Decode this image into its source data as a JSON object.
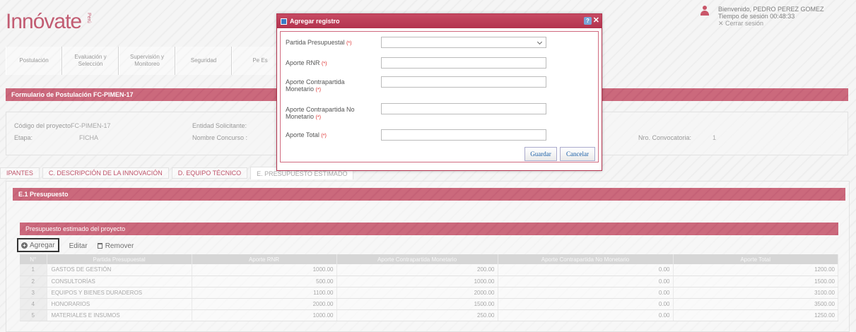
{
  "header": {
    "logo_text": "Innóvate",
    "logo_suffix": "Perú",
    "welcome": "Bienvenido, PEDRO PEREZ GOMEZ",
    "session_time": "Tiempo de sesión 00:48:33",
    "logout": "✕ Cerrar sesión"
  },
  "menu": [
    "Postulación",
    "Evaluación y Selección",
    "Supervisión y Monitoreo",
    "Seguridad",
    "Pe Es"
  ],
  "form_title": "Formulario de Postulación FC-PIMEN-17",
  "info": {
    "codigo_label": "Código del proyecto:",
    "codigo_value": "FC-PIMEN-17",
    "etapa_label": "Etapa:",
    "etapa_value": "FICHA",
    "entidad_label": "Entidad Solicitante:",
    "concurso_label": "Nombre Concurso :",
    "convocatoria_label": "Nro. Convocatoria:",
    "convocatoria_value": "1"
  },
  "tabs": [
    "IPANTES",
    "C. DESCRIPCIÓN DE LA INNOVACIÓN",
    "D. EQUIPO TÉCNICO",
    "E. PRESUPUESTO ESTIMADO"
  ],
  "section_e1": "E.1 Presupuesto",
  "section_pe": "Presupuesto estimado del proyecto",
  "toolbar": {
    "add": "Agregar",
    "edit": "Editar",
    "remove": "Remover"
  },
  "table": {
    "headers": [
      "N°",
      "Partida Presupuestal",
      "Aporte RNR",
      "Aporte Contrapartida Monetario",
      "Aporte Contrapartida No Monetario",
      "Aporte Total"
    ],
    "rows": [
      [
        "1",
        "Gastos de Gestión",
        "1000.00",
        "200.00",
        "0.00",
        "1200.00"
      ],
      [
        "2",
        "Consultorías",
        "500.00",
        "1000.00",
        "0.00",
        "1500.00"
      ],
      [
        "3",
        "Equipos y Bienes Duraderos",
        "1100.00",
        "2000.00",
        "0.00",
        "3100.00"
      ],
      [
        "4",
        "Honorarios",
        "2000.00",
        "1500.00",
        "0.00",
        "3500.00"
      ],
      [
        "5",
        "Materiales e Insumos",
        "1000.00",
        "250.00",
        "0.00",
        "1250.00"
      ]
    ]
  },
  "dialog": {
    "title": "Agregar registro",
    "help": "?",
    "close": "✕",
    "fields": [
      {
        "label": "Partida Presupuestal",
        "req": "(*)"
      },
      {
        "label": "Aporte RNR",
        "req": "(*)"
      },
      {
        "label": "Aporte Contrapartida Monetario",
        "req": "(*)"
      },
      {
        "label": "Aporte Contrapartida No Monetario",
        "req": "(*)"
      },
      {
        "label": "Aporte Total",
        "req": "(*)"
      }
    ],
    "save": "Guardar",
    "cancel": "Cancelar"
  },
  "colors": {
    "brand": "#b3334e",
    "link": "#1a5fa8"
  }
}
